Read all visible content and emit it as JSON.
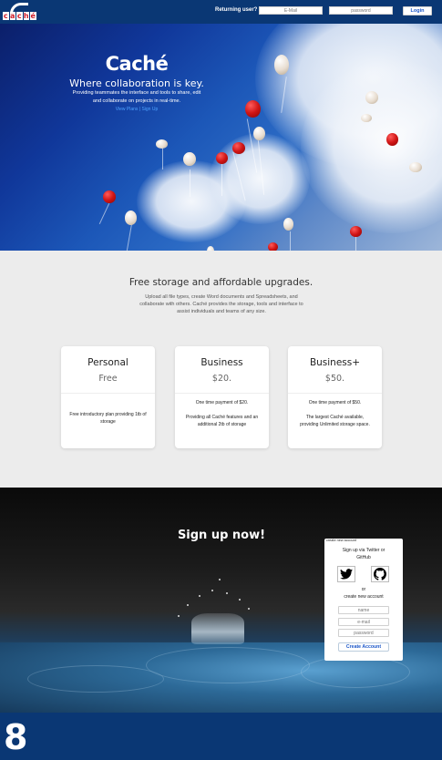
{
  "nav": {
    "logo_letters": [
      "c",
      "a",
      "c",
      "h",
      "é"
    ],
    "returning_label": "Returning user?",
    "email_placeholder": "E-Mail",
    "password_placeholder": "password",
    "login_label": "Login"
  },
  "hero": {
    "title": "Caché",
    "subtitle": "Where collaboration is key.",
    "description": "Providing teammates the interface and tools to share, edit and collaborate on projects in real-time.",
    "links": "View Plans | Sign Up"
  },
  "pricing": {
    "title": "Free storage and affordable upgrades.",
    "description": "Upload all file types, create Word documents and Spreadsheets, and collaborate with others. Caché provides the storage, tools and interface to assist individuals and teams of any size.",
    "plans": [
      {
        "name": "Personal",
        "price": "Free",
        "desc1": "Free introductory plan providing 1tb of storage",
        "desc2": ""
      },
      {
        "name": "Business",
        "price": "$20.",
        "desc1": "One time payment of $20.",
        "desc2": "Providing all Caché features and an additional 2tb of storage"
      },
      {
        "name": "Business+",
        "price": "$50.",
        "desc1": "One time payment of $50.",
        "desc2": "The largest Caché available, providing Unlimited storage space."
      }
    ]
  },
  "signup": {
    "title": "Sign up now!",
    "panel_header": "create new account",
    "via_text": "Sign up via Twitter or GitHub",
    "or_text": "or",
    "create_new_text": "create new account",
    "name_placeholder": "name",
    "email_placeholder": "e-mail",
    "password_placeholder": "password",
    "create_button": "Create Account",
    "icons": [
      "twitter-icon",
      "github-icon"
    ]
  },
  "footer": {
    "number": "8"
  },
  "colors": {
    "brand_navy": "#0a3774",
    "logo_red": "#d0202c",
    "link_blue": "#1a56c9",
    "pricing_bg": "#ececec"
  }
}
